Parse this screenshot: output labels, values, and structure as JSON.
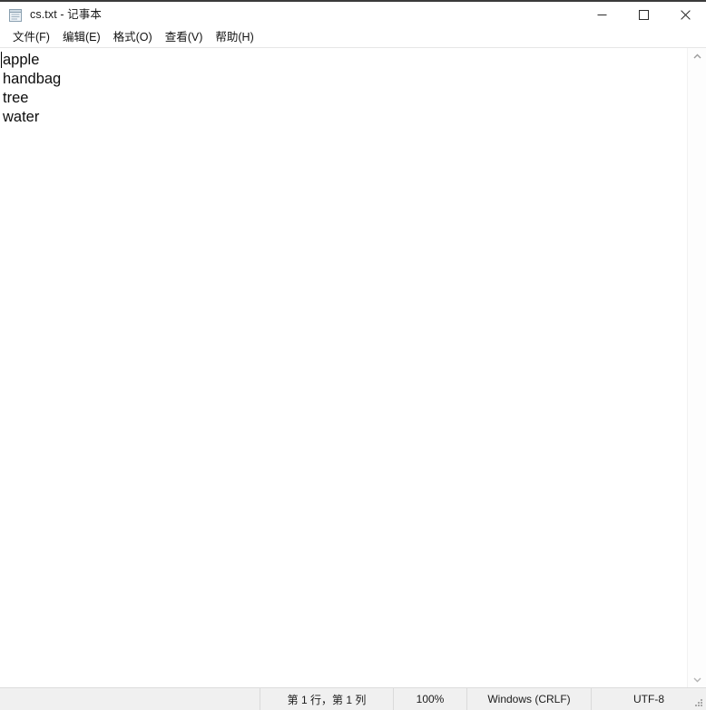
{
  "window": {
    "title": "cs.txt - 记事本",
    "icon": "notepad-icon",
    "controls": {
      "minimize_label": "最小化",
      "maximize_label": "最大化",
      "close_label": "关闭"
    }
  },
  "menubar": {
    "items": [
      {
        "label": "文件(F)",
        "name": "menu-file"
      },
      {
        "label": "编辑(E)",
        "name": "menu-edit"
      },
      {
        "label": "格式(O)",
        "name": "menu-format"
      },
      {
        "label": "查看(V)",
        "name": "menu-view"
      },
      {
        "label": "帮助(H)",
        "name": "menu-help"
      }
    ]
  },
  "editor": {
    "lines": [
      "apple",
      "handbag",
      "tree",
      "water"
    ],
    "caret_line": 1,
    "caret_column": 1
  },
  "scrollbar": {
    "up_arrow": "chevron-up-icon",
    "down_arrow": "chevron-down-icon"
  },
  "statusbar": {
    "position": "第 1 行，第 1 列",
    "zoom": "100%",
    "line_ending": "Windows (CRLF)",
    "encoding": "UTF-8"
  },
  "colors": {
    "window_bg": "#ffffff",
    "titlebar_bg": "#ffffff",
    "top_border": "#3b3b3b",
    "statusbar_bg": "#f0f0f0",
    "text": "#0d0d0d"
  }
}
